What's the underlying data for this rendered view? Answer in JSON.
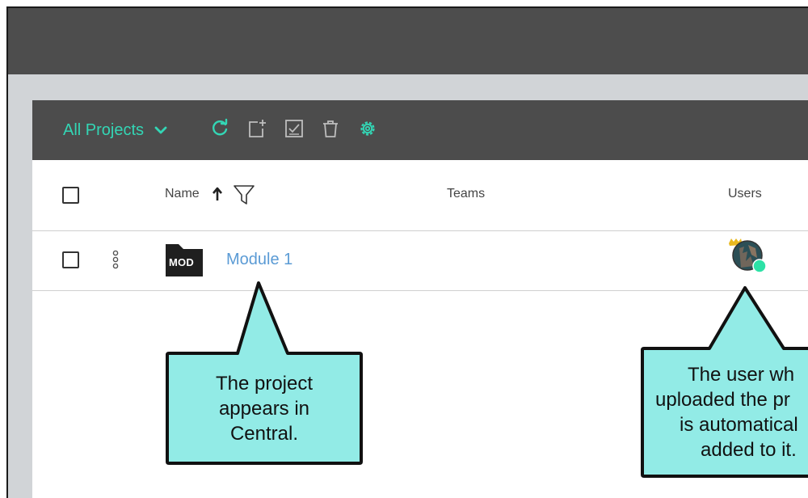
{
  "toolbar": {
    "project_filter_label": "All Projects",
    "accent_color": "#33d6b5",
    "icons": [
      "refresh-icon",
      "new-project-icon",
      "checklist-icon",
      "trash-icon",
      "settings-icon"
    ]
  },
  "table": {
    "columns": {
      "name": "Name",
      "teams": "Teams",
      "users": "Users"
    },
    "sort": {
      "column": "Name",
      "direction": "ascending"
    },
    "rows": [
      {
        "badge": "MOD",
        "name": "Module 1",
        "teams": "",
        "users_online": true
      }
    ]
  },
  "callouts": {
    "left": [
      "The project",
      "appears in",
      "Central."
    ],
    "right": [
      "The user wh",
      "uploaded the pr",
      "is automatical",
      "added to it."
    ],
    "fill_color": "#92ebe6"
  }
}
